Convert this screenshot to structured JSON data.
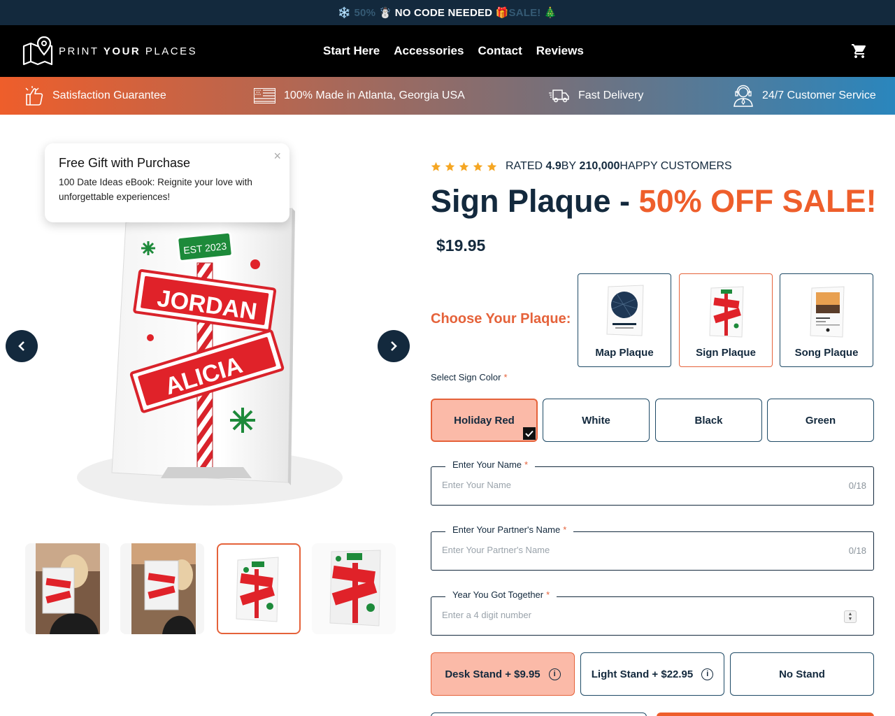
{
  "promo": {
    "prefix": "❄️ 50% ",
    "main": "☃️ NO CODE NEEDED ",
    "gift": "🎁",
    "suffix": "SALE! 🎄"
  },
  "brand": {
    "word_light_1": "PRINT ",
    "word_bold": "YOUR",
    "word_light_2": " PLACES"
  },
  "nav": [
    "Start Here",
    "Accessories",
    "Contact",
    "Reviews"
  ],
  "benefits": [
    {
      "label": "Satisfaction Guarantee",
      "icon": "thumbs-up-icon"
    },
    {
      "label": "100% Made in Atlanta, Georgia USA",
      "icon": "us-flag-icon"
    },
    {
      "label": "Fast Delivery",
      "icon": "delivery-truck-icon"
    },
    {
      "label": "24/7 Customer Service",
      "icon": "support-agent-icon"
    }
  ],
  "popup": {
    "title": "Free Gift with Purchase",
    "body": "100 Date Ideas eBook: Reignite your love with unforgettable experiences!",
    "close": "×"
  },
  "product_image": {
    "est": "EST 2023",
    "name1": "JORDAN",
    "name2": "ALICIA"
  },
  "rating": {
    "prefix": "RATED ",
    "score": "4.9",
    "mid": " BY ",
    "count": "210,000",
    "suffix": " HAPPY CUSTOMERS",
    "stars": 5
  },
  "product": {
    "title_main": "Sign Plaque - ",
    "title_sale": "50% OFF SALE!",
    "price": "$19.95"
  },
  "plaque": {
    "label": "Choose Your Plaque:",
    "options": [
      "Map Plaque",
      "Sign Plaque",
      "Song Plaque"
    ],
    "selected": "Sign Plaque"
  },
  "sign_color": {
    "label": "Select Sign Color",
    "required": "*",
    "options": [
      "Holiday Red",
      "White",
      "Black",
      "Green"
    ],
    "selected": "Holiday Red"
  },
  "fields": {
    "name": {
      "label": "Enter Your Name",
      "placeholder": "Enter Your Name",
      "counter": "0/18"
    },
    "partner": {
      "label": "Enter Your Partner's Name",
      "placeholder": "Enter Your Partner's Name",
      "counter": "0/18"
    },
    "year": {
      "label": "Year You Got Together",
      "placeholder": "Enter a 4 digit number"
    }
  },
  "stands": {
    "options": [
      "Desk Stand + $9.95",
      "Light Stand + $22.95",
      "No Stand"
    ],
    "selected": "Desk Stand + $9.95"
  },
  "colors": {
    "navy": "#13293d",
    "accent": "#ee5e2b",
    "selected_fill": "#fbbaa8"
  }
}
